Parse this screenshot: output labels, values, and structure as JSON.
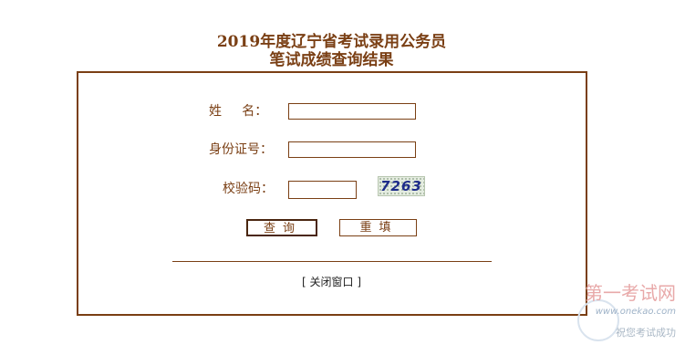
{
  "header": {
    "title_line1": "2019年度辽宁省考试录用公务员",
    "title_line2": "笔试成绩查询结果"
  },
  "form": {
    "name_label": "姓     名：",
    "name_value": "",
    "idcard_label": "身份证号：",
    "idcard_value": "",
    "captcha_label": "校验码：",
    "captcha_value": "",
    "captcha_text": "7263"
  },
  "buttons": {
    "query_label": "查询",
    "reset_label": "重填"
  },
  "footer": {
    "close_open": "[",
    "close_label": "关闭窗口",
    "close_end": "]"
  },
  "watermark": {
    "site": "第一考试网",
    "url": "www.onekao.com",
    "slogan": "祝您考试成功"
  },
  "colors": {
    "accent": "#7a3f14",
    "captcha_text": "#1e2c8a",
    "watermark_red": "#e8a9a9"
  }
}
